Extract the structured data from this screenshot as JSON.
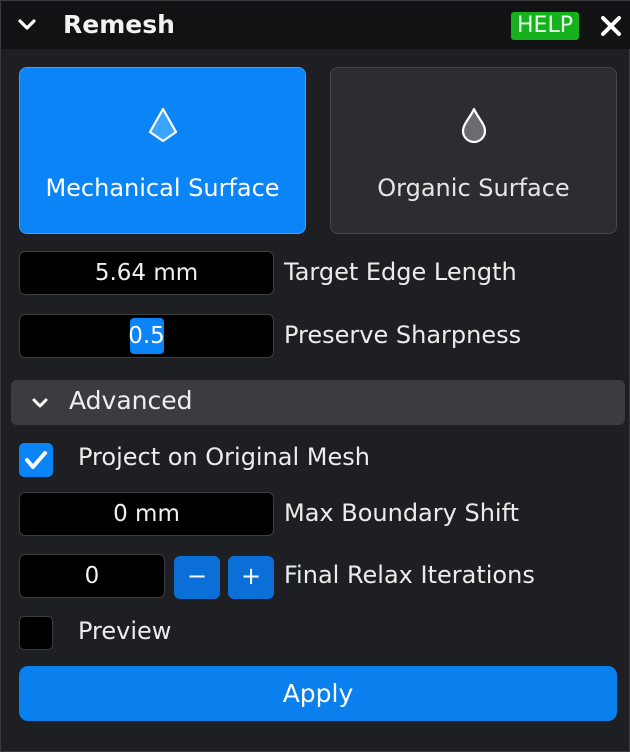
{
  "panel": {
    "title": "Remesh",
    "help_label": "HELP"
  },
  "modes": [
    {
      "label": "Mechanical Surface",
      "icon": "drop-angular-icon",
      "selected": true
    },
    {
      "label": "Organic Surface",
      "icon": "drop-round-icon",
      "selected": false
    }
  ],
  "params": {
    "target_edge_length": {
      "value": "5.64 mm",
      "label": "Target Edge Length"
    },
    "preserve_sharpness": {
      "value": "0.5",
      "label": "Preserve Sharpness"
    }
  },
  "advanced": {
    "title": "Advanced",
    "project_on_original_mesh": {
      "label": "Project on Original Mesh",
      "checked": true
    },
    "max_boundary_shift": {
      "value": "0 mm",
      "label": "Max Boundary Shift"
    },
    "final_relax_iterations": {
      "value": "0",
      "label": "Final Relax Iterations",
      "minus": "−",
      "plus": "+"
    }
  },
  "preview": {
    "label": "Preview",
    "checked": false
  },
  "apply_label": "Apply",
  "colors": {
    "accent": "#0a84f7",
    "help_green": "#16b21d",
    "panel_bg": "#1e1f22",
    "title_bg": "#111213"
  }
}
